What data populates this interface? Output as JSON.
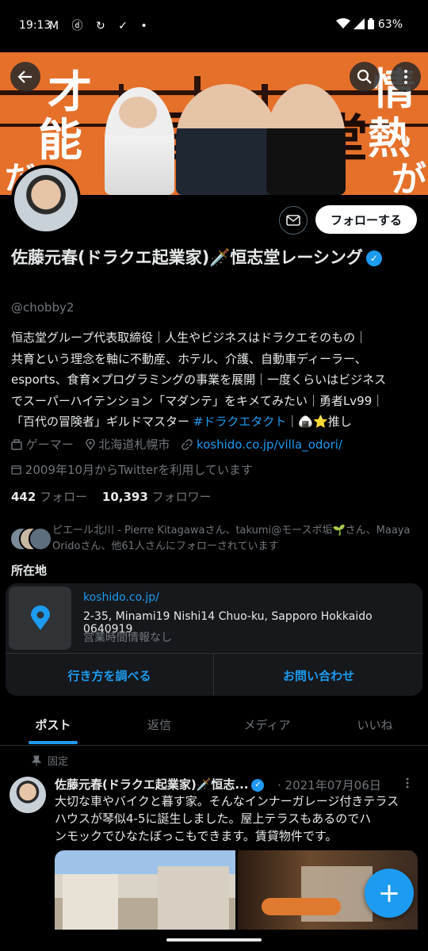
{
  "status_bar": {
    "time": "19:13",
    "notification_icons": "M ⓓ ↻ ✓ •",
    "battery": "63%"
  },
  "banner": {
    "left_text": [
      "才",
      "能",
      "だ"
    ],
    "right_text": [
      "情",
      "熱",
      "が"
    ],
    "mid_text": [
      "恒",
      "志",
      "堂"
    ]
  },
  "header_actions": {
    "follow_label": "フォローする"
  },
  "profile": {
    "name": "佐藤元春(ドラクエ起業家)🗡️恒志堂レーシング",
    "handle": "@chobby2",
    "bio_lines": [
      "恒志堂グループ代表取締役｜人生やビジネスはドラクエそのもの｜",
      "共育という理念を軸に不動産、ホテル、介護、自動車ディーラー、",
      "esports、食育×プログラミングの事業を展開｜一度くらいはビジネス",
      "でスーパーハイテンション「マダンテ」をキメてみたい｜勇者Lv99｜",
      "「百代の冒険者」ギルドマスター "
    ],
    "bio_hashtag": "#ドラクエタクト",
    "bio_tail": "｜🍙⭐推し",
    "category": "ゲーマー",
    "location": "北海道札幌市",
    "website": "koshido.co.jp/villa_odori/",
    "joined": "2009年10月からTwitterを利用しています",
    "following_count": "442",
    "following_label": "フォロー",
    "followers_count": "10,393",
    "followers_label": "フォロワー",
    "followed_by": "ピエール北川 - Pierre Kitagawaさん、takumi@モースポ垢🌱さん、Maaya Oridoさん、他61人さんにフォローされています"
  },
  "location_card": {
    "section_label": "所在地",
    "url": "koshido.co.jp/",
    "address": "2-35, Minami19 Nishi14 Chuo-ku, Sapporo Hokkaido 0640919",
    "hours": "営業時間情報なし",
    "directions_label": "行き方を調べる",
    "contact_label": "お問い合わせ"
  },
  "tabs": [
    "ポスト",
    "返信",
    "メディア",
    "いいね"
  ],
  "pinned_post": {
    "pinned_label": "固定",
    "author": "佐藤元春(ドラクエ起業家)🗡️恒志...",
    "date": "· 2021年07月06日",
    "text_lines": [
      "大切な車やバイクと暮す家。そんなインナーガレージ付きテラス",
      "ハウスが琴似4-5に誕生しました。屋上テラスもあるのでハ",
      "ンモックでひなたぼっこもできます。賃貸物件です。"
    ]
  },
  "fab_label": "+",
  "colors": {
    "accent": "#1d9bf0",
    "banner_orange": "#e5702a",
    "background": "#000000"
  }
}
